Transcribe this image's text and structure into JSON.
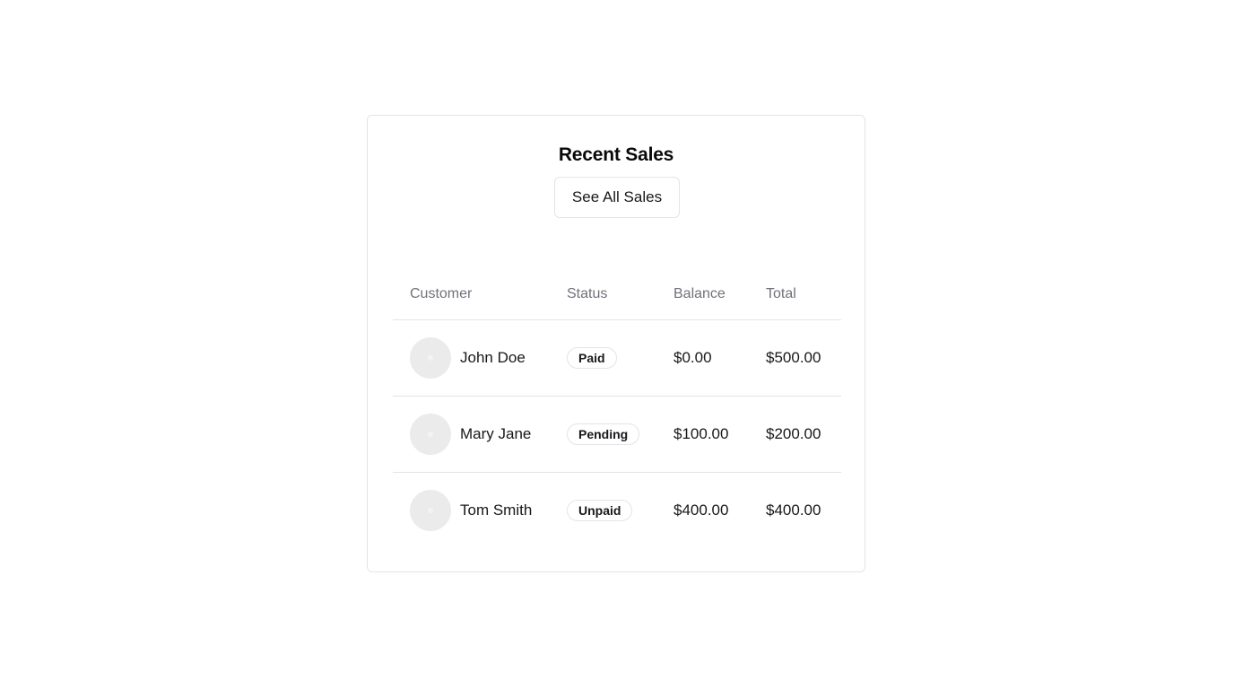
{
  "card": {
    "title": "Recent Sales",
    "see_all_label": "See All Sales"
  },
  "table": {
    "headers": {
      "customer": "Customer",
      "status": "Status",
      "balance": "Balance",
      "total": "Total"
    },
    "rows": [
      {
        "customer": "John Doe",
        "status": "Paid",
        "balance": "$0.00",
        "total": "$500.00"
      },
      {
        "customer": "Mary Jane",
        "status": "Pending",
        "balance": "$100.00",
        "total": "$200.00"
      },
      {
        "customer": "Tom Smith",
        "status": "Unpaid",
        "balance": "$400.00",
        "total": "$400.00"
      }
    ]
  },
  "colors": {
    "border": "#e4e4e7",
    "muted_text": "#71717a",
    "text": "#18181b",
    "avatar_placeholder": "#ebebeb"
  }
}
